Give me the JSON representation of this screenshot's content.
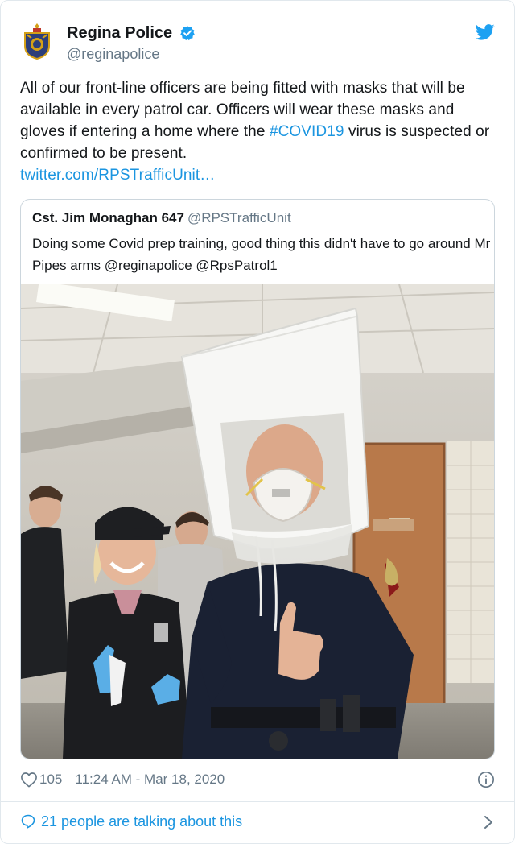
{
  "tweet": {
    "author": {
      "display_name": "Regina Police",
      "handle": "@reginapolice",
      "verified": true
    },
    "text_before_hashtag": "All of our front-line officers are being fitted with masks that will be available in every patrol car. Officers will wear these masks and gloves if entering a home where the ",
    "hashtag": "#COVID19",
    "text_after_hashtag": " virus is suspected or confirmed to be present.",
    "link": "twitter.com/RPSTrafficUnit…",
    "likes": "105",
    "timestamp": "11:24 AM - Mar 18, 2020",
    "talking": "21 people are talking about this"
  },
  "quoted": {
    "display_name": "Cst. Jim Monaghan 647",
    "handle": "@RPSTrafficUnit",
    "text": "Doing some Covid prep training, good thing this didn't have to go around Mr Pipes arms @reginapolice @RpsPatrol1"
  },
  "icons": {
    "bird": "twitter-bird-icon",
    "verified": "verified-badge-icon",
    "heart": "heart-icon",
    "info": "info-icon",
    "talk": "speech-bubble-icon",
    "chevron": "chevron-right-icon"
  },
  "colors": {
    "accent": "#1b95e0",
    "muted": "#657786",
    "text": "#14171a",
    "border": "#e1e8ed"
  }
}
